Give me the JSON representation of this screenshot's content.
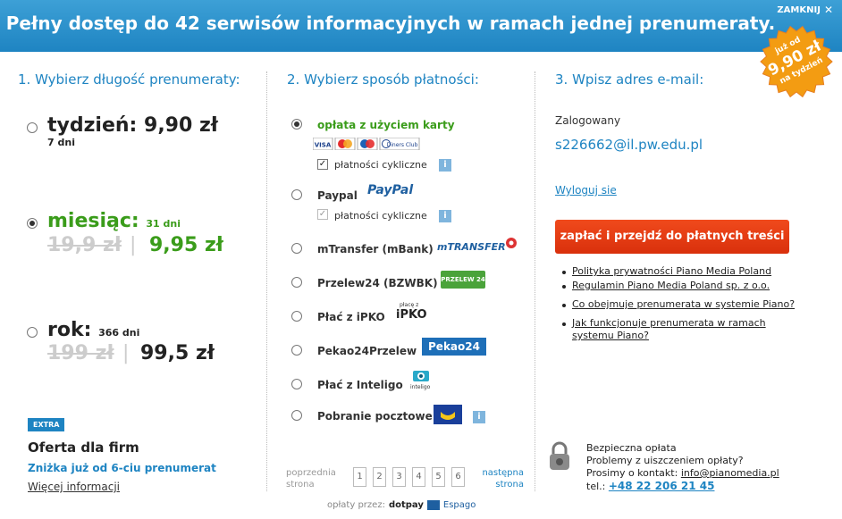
{
  "header": {
    "title": "Pełny dostęp do 42 serwisów informacyjnych w ramach jednej prenumeraty.",
    "close_label": "ZAMKNIJ"
  },
  "badge": {
    "line1": "już od",
    "line2": "9,90 zł",
    "line3": "na tydzień"
  },
  "col1": {
    "title": "1. Wybierz długość prenumeraty:",
    "plans": [
      {
        "name": "tydzień:",
        "price": "9,90 zł",
        "days": "7 dni",
        "selected": false
      },
      {
        "name": "miesiąc:",
        "days": "31 dni",
        "old_price": "19,9 zł",
        "sep": "|",
        "price": "9,95 zł",
        "selected": true
      },
      {
        "name": "rok:",
        "days": "366 dni",
        "old_price": "199 zł",
        "sep": "|",
        "price": "99,5 zł",
        "selected": false
      }
    ],
    "extra": {
      "badge": "EXTRA",
      "title": "Oferta dla firm",
      "subtitle": "Zniżka już od 6-ciu prenumerat",
      "more": "Więcej informacji"
    }
  },
  "col2": {
    "title": "2. Wybierz sposób płatności:",
    "methods": [
      {
        "label": "opłata z użyciem karty",
        "selected": true
      },
      {
        "label": "Paypal",
        "selected": false
      },
      {
        "label": "mTransfer (mBank)",
        "selected": false
      },
      {
        "label": "Przelew24 (BZWBK)",
        "selected": false
      },
      {
        "label": "Płać z iPKO",
        "selected": false
      },
      {
        "label": "Pekao24Przelew",
        "selected": false
      },
      {
        "label": "Płać z Inteligo",
        "selected": false
      },
      {
        "label": "Pobranie pocztowe",
        "selected": false
      }
    ],
    "recurring_label": "płatności cykliczne",
    "card_logos": [
      "VISA",
      "MC",
      "Maestro",
      "Diners Club"
    ],
    "logos": {
      "paypal": "PayPal",
      "mtransfer": "mTRANSFER",
      "przelew24": "PRZELEW 24",
      "ipko_small": "płacę z",
      "ipko": "iPKO",
      "pekao": "Pekao24",
      "inteligo": "inteligo"
    },
    "pager": {
      "prev": [
        "poprzednia",
        "strona"
      ],
      "pages": [
        "1",
        "2",
        "3",
        "4",
        "5",
        "6"
      ],
      "next": [
        "następna",
        "strona"
      ]
    },
    "paid_by": {
      "label": "opłaty przez:",
      "dotpay": "dotpay",
      "espago": "Espago"
    }
  },
  "col3": {
    "title": "3. Wpisz adres e-mail:",
    "logged_label": "Zalogowany",
    "email": "s226662@il.pw.edu.pl",
    "logout": "Wyloguj sie",
    "pay_button": "zapłać i przejdź do płatnych treści",
    "links": [
      "Polityka prywatności Piano Media Poland",
      "Regulamin Piano Media Poland sp. z o.o.",
      "Co obejmuje prenumerata w systemie Piano?",
      "Jak funkcjonuje prenumerata w ramach",
      "systemu Piano?"
    ],
    "secure": {
      "line1": "Bezpieczna opłata",
      "line2": "Problemy z uiszczeniem opłaty?",
      "line3_prefix": "Prosimy o kontakt:",
      "email": "info@pianomedia.pl",
      "phone_prefix": "tel.:",
      "phone": "+48 22 206 21 45"
    }
  }
}
